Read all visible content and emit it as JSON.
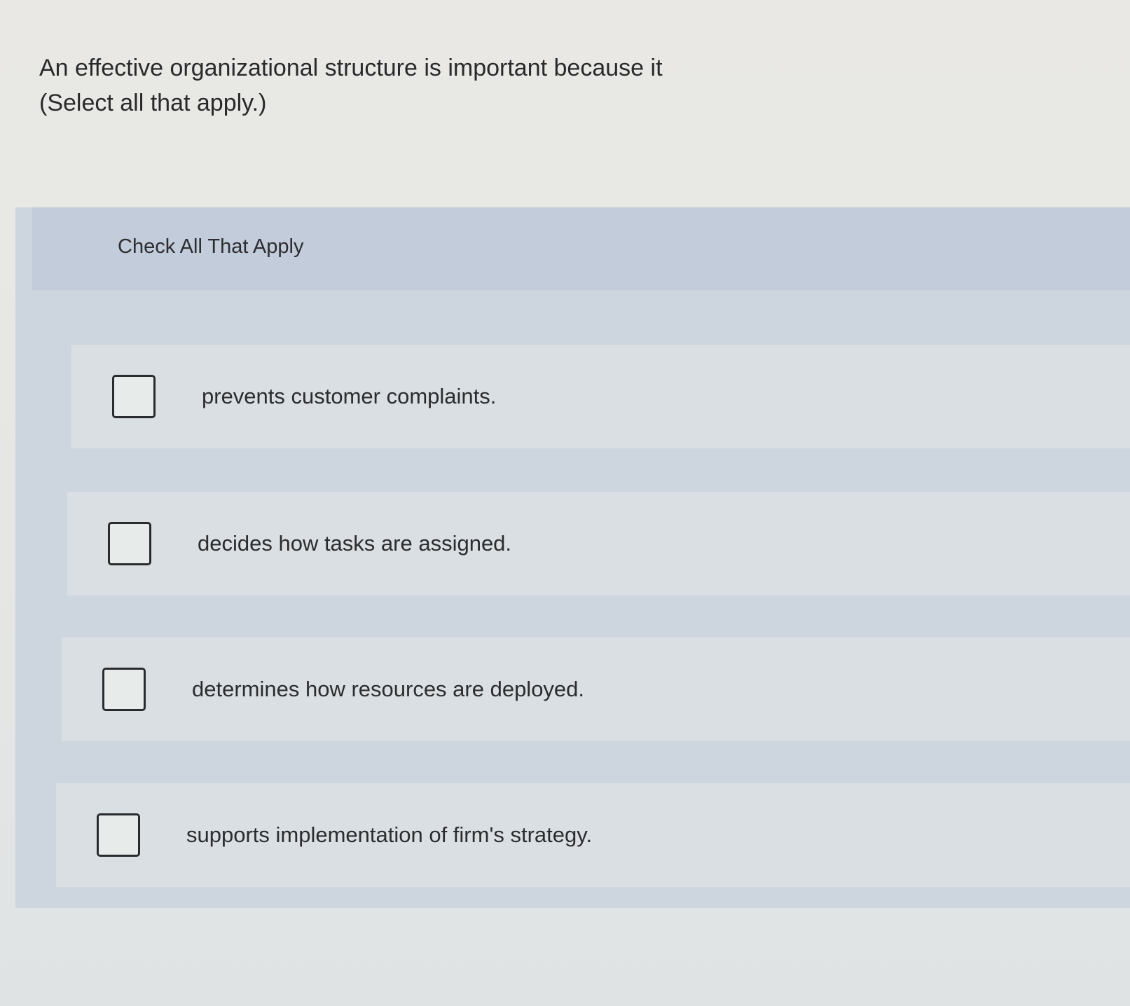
{
  "question": {
    "line1": "An effective organizational structure is important because it",
    "line2": "(Select all that apply.)"
  },
  "panel": {
    "title": "Check All That Apply"
  },
  "options": [
    {
      "label": "prevents customer complaints.",
      "checked": false
    },
    {
      "label": "decides how tasks are assigned.",
      "checked": false
    },
    {
      "label": "determines how resources are deployed.",
      "checked": false
    },
    {
      "label": "supports implementation of firm's strategy.",
      "checked": false
    }
  ]
}
